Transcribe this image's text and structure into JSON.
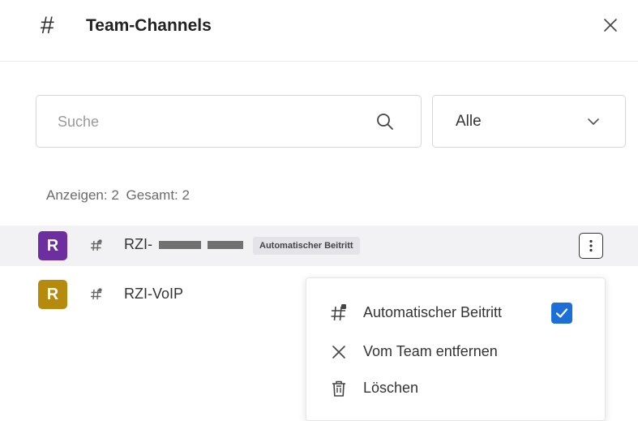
{
  "header": {
    "title": "Team-Channels",
    "icon": "hash-icon",
    "close_icon": "close-icon"
  },
  "search": {
    "placeholder": "Suche",
    "value": "",
    "icon": "search-icon"
  },
  "filter": {
    "selected": "Alle",
    "icon": "chevron-down-icon"
  },
  "counts": {
    "shown": "Anzeigen: 2",
    "total": "Gesamt: 2"
  },
  "channels": [
    {
      "avatar_letter": "R",
      "avatar_color": "#6d2ea0",
      "name_visible": "RZI-",
      "badge": "Automatischer Beitritt",
      "selected": true
    },
    {
      "avatar_letter": "R",
      "avatar_color": "#b68a0c",
      "name_visible": "RZI-VoIP"
    }
  ],
  "context_menu": {
    "items": [
      {
        "label": "Automatischer Beitritt",
        "icon": "channel-icon",
        "checked": true
      },
      {
        "label": "Vom Team entfernen",
        "icon": "close-icon"
      },
      {
        "label": "Löschen",
        "icon": "trash-icon"
      }
    ]
  },
  "colors": {
    "accent": "#1b6fd6",
    "row_highlight": "#f2f2f4"
  }
}
